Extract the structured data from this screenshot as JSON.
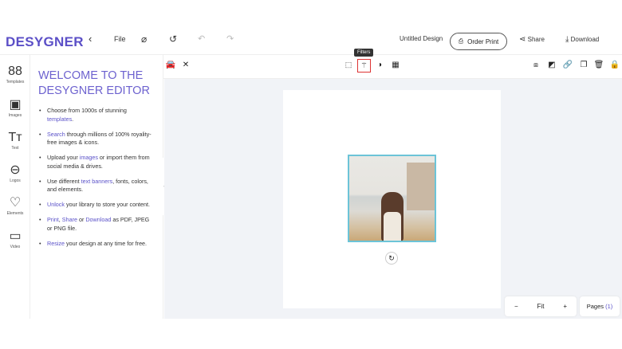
{
  "header": {
    "logo": "DESYGNER",
    "file_label": "File",
    "design_name": "Untitled Design",
    "order_print": "Order Print",
    "share": "Share",
    "download": "Download"
  },
  "sidebar": {
    "items": [
      {
        "label": "Templates",
        "icon": "templates-icon"
      },
      {
        "label": "Images",
        "icon": "image-icon"
      },
      {
        "label": "Text",
        "icon": "text-icon"
      },
      {
        "label": "Logos",
        "icon": "logos-icon"
      },
      {
        "label": "Elements",
        "icon": "heart-icon"
      },
      {
        "label": "Video",
        "icon": "video-icon"
      }
    ]
  },
  "panel": {
    "title_line1": "WELCOME TO THE",
    "title_line2": "DESYGNER EDITOR",
    "bullets": [
      [
        {
          "t": "Choose from 1000s of stunning "
        },
        {
          "t": "templates",
          "link": true
        },
        {
          "t": "."
        }
      ],
      [
        {
          "t": "Search",
          "link": true
        },
        {
          "t": " through millions of 100% royality-free images & icons."
        }
      ],
      [
        {
          "t": "Upload your "
        },
        {
          "t": "images",
          "link": true
        },
        {
          "t": " or import them from social media & drives."
        }
      ],
      [
        {
          "t": "Use different "
        },
        {
          "t": "text banners",
          "link": true
        },
        {
          "t": ", fonts, colors, and elements."
        }
      ],
      [
        {
          "t": "Unlock",
          "link": true
        },
        {
          "t": " your library to store your content."
        }
      ],
      [
        {
          "t": "Print",
          "link": true
        },
        {
          "t": ", "
        },
        {
          "t": "Share",
          "link": true
        },
        {
          "t": " or "
        },
        {
          "t": "Download",
          "link": true
        },
        {
          "t": " as PDF, JPEG or PNG file."
        }
      ],
      [
        {
          "t": "Resize",
          "link": true
        },
        {
          "t": " your design at any time for free."
        }
      ]
    ]
  },
  "toolbar": {
    "tooltip": "Filters"
  },
  "zoom": {
    "minus": "−",
    "fit": "Fit",
    "plus": "+"
  },
  "pages": {
    "label": "Pages",
    "count": "(1)"
  },
  "colors": {
    "brand": "#5b4fc7",
    "selection": "#6cc4d8",
    "highlight": "#dd3333"
  }
}
